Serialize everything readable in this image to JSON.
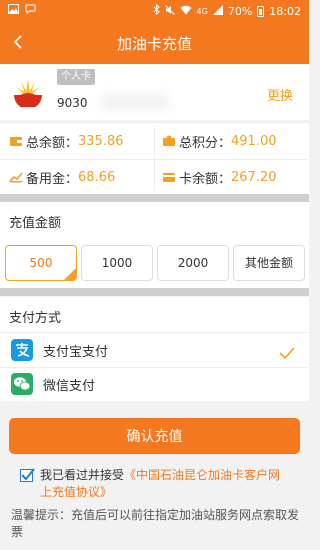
{
  "status_bar": {
    "battery_percent": "70%",
    "time": "18:02",
    "network": "4G"
  },
  "header": {
    "title": "加油卡充值",
    "back_icon": "chevron-left-icon"
  },
  "card": {
    "holder_tag": "个人卡",
    "card_number_visible": "9030",
    "change_label": "更换"
  },
  "stats": {
    "total_balance_label": "总余额：",
    "total_balance_value": "335.86",
    "total_points_label": "总积分：",
    "total_points_value": "491.00",
    "reserve_label": "备用金：",
    "reserve_value": "68.66",
    "card_balance_label": "卡余额：",
    "card_balance_value": "267.20"
  },
  "amount": {
    "section_title": "充值金额",
    "options": [
      "500",
      "1000",
      "2000",
      "其他金额"
    ],
    "selected": "500"
  },
  "payment": {
    "section_title": "支付方式",
    "methods": [
      {
        "label": "支付宝支付",
        "icon": "alipay-icon",
        "selected": true
      },
      {
        "label": "微信支付",
        "icon": "wechat-icon",
        "selected": false
      }
    ]
  },
  "confirm_label": "确认充值",
  "agreement": {
    "prefix": "我已看过并接受",
    "link": "《中国石油昆仑加油卡客户网上充值协议》",
    "checked": true
  },
  "tip": "温馨提示：充值后可以前往指定加油站服务网点索取发票",
  "colors": {
    "brand_orange": "#f4781f",
    "accent_amber": "#f5a020",
    "alipay_blue": "#1a9ae0",
    "wechat_green": "#2aae67"
  }
}
